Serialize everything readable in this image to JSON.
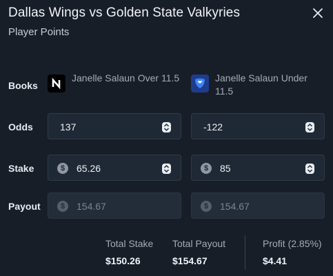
{
  "header": {
    "title": "Dallas Wings vs Golden State Valkyries",
    "subtitle": "Player Points"
  },
  "rows": {
    "books_label": "Books",
    "odds_label": "Odds",
    "stake_label": "Stake",
    "payout_label": "Payout"
  },
  "books": [
    {
      "name": "Janelle Salaun Over 11.5",
      "logo": "n-logo-icon"
    },
    {
      "name": "Janelle Salaun Under 11.5",
      "logo": "shield-logo-icon"
    }
  ],
  "odds": [
    "137",
    "-122"
  ],
  "stakes": [
    "65.26",
    "85"
  ],
  "payouts": [
    "154.67",
    "154.67"
  ],
  "currency_symbol": "$",
  "summary": {
    "total_stake_label": "Total Stake",
    "total_stake_value": "$150.26",
    "total_payout_label": "Total Payout",
    "total_payout_value": "$154.67",
    "profit_label": "Profit (2.85%)",
    "profit_value": "$4.41"
  },
  "colors": {
    "background": "#171e28",
    "field": "#1f2935",
    "field_border": "#2f3b49"
  }
}
